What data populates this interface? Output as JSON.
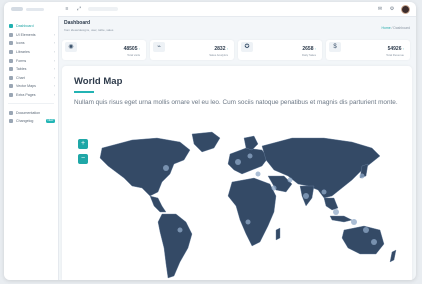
{
  "sidebar": {
    "items": [
      {
        "label": "Dashboard",
        "active": true
      },
      {
        "label": "UI Elements",
        "chevron": true
      },
      {
        "label": "Icons",
        "chevron": true
      },
      {
        "label": "Libraries",
        "chevron": true
      },
      {
        "label": "Forms",
        "chevron": true
      },
      {
        "label": "Tables",
        "chevron": true
      },
      {
        "label": "Chart",
        "chevron": true
      },
      {
        "label": "Vector Maps",
        "chevron": true
      },
      {
        "label": "Extra Pages",
        "chevron": true
      },
      {
        "label": "Documentation"
      },
      {
        "label": "Changelog",
        "badge": "NEW"
      }
    ]
  },
  "header": {
    "title": "Dashboard",
    "subtitle": "from ideas/designs, user, table, sales",
    "breadcrumb_home": "Home",
    "breadcrumb_sep": " / ",
    "breadcrumb_current": "Dashboard"
  },
  "stats": [
    {
      "icon": "eye-icon",
      "value": "48505",
      "delta": "↑",
      "label": "Total visits"
    },
    {
      "icon": "chart-icon",
      "value": "2832",
      "delta": "↑",
      "label": "Sales Analytics"
    },
    {
      "icon": "compass-icon",
      "value": "2658",
      "delta": "↑",
      "label": "Daily Sales"
    },
    {
      "icon": "dollar-icon",
      "value": "54926",
      "delta": "↑",
      "label": "Total Revenue"
    }
  ],
  "map": {
    "title": "World Map",
    "description": "Nullam quis risus eget urna mollis ornare vel eu leo. Cum sociis natoque penatibus et magnis dis parturient monte.",
    "zoom_in": "+",
    "zoom_out": "−",
    "land_color": "#344a66",
    "highlight_color": "#8fa9c8"
  },
  "colors": {
    "accent": "#21b0b0",
    "background": "#f3f6f9"
  }
}
